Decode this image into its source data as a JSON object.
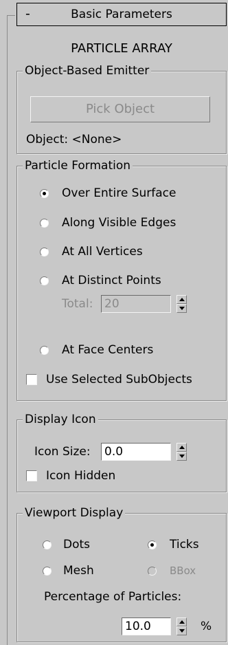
{
  "rollout": {
    "collapse_symbol": "-",
    "title": "Basic Parameters"
  },
  "section_title": "PARTICLE ARRAY",
  "object_based_emitter": {
    "legend": "Object-Based Emitter",
    "pick_button": "Pick Object",
    "object_label": "Object: <None>"
  },
  "particle_formation": {
    "legend": "Particle Formation",
    "options": [
      {
        "label": "Over Entire Surface",
        "selected": true
      },
      {
        "label": "Along Visible Edges",
        "selected": false
      },
      {
        "label": "At All Vertices",
        "selected": false
      },
      {
        "label": "At Distinct Points",
        "selected": false
      },
      {
        "label": "At Face Centers",
        "selected": false
      }
    ],
    "total_label": "Total:",
    "total_value": "20",
    "use_selected_label": "Use Selected SubObjects",
    "use_selected_checked": false
  },
  "display_icon": {
    "legend": "Display Icon",
    "icon_size_label": "Icon Size:",
    "icon_size_value": "0.0",
    "icon_hidden_label": "Icon Hidden",
    "icon_hidden_checked": false
  },
  "viewport_display": {
    "legend": "Viewport Display",
    "options": [
      {
        "label": "Dots",
        "selected": false,
        "enabled": true
      },
      {
        "label": "Ticks",
        "selected": true,
        "enabled": true
      },
      {
        "label": "Mesh",
        "selected": false,
        "enabled": true
      },
      {
        "label": "BBox",
        "selected": false,
        "enabled": false
      }
    ],
    "percentage_label": "Percentage of Particles:",
    "percentage_value": "10.0",
    "percent_unit": "%"
  }
}
